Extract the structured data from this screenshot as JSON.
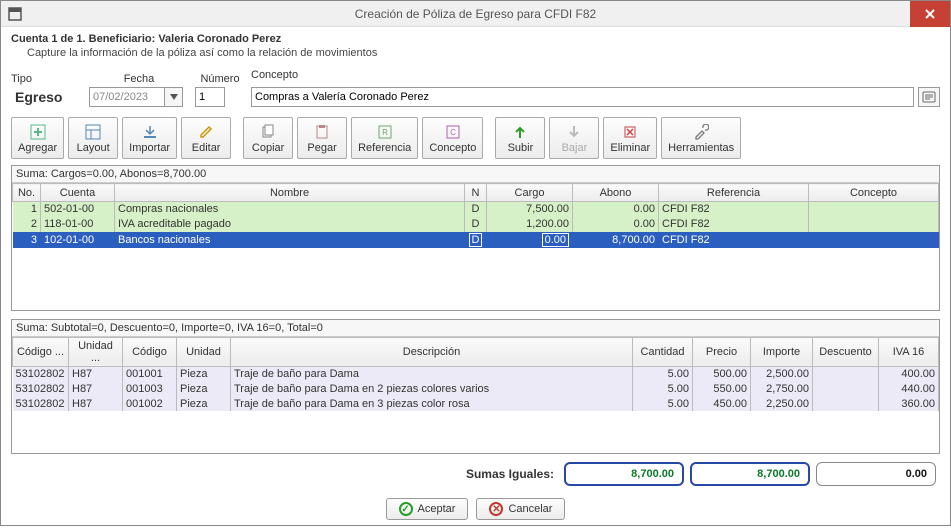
{
  "window": {
    "title": "Creación de Póliza de Egreso para CFDI F82"
  },
  "subheader": {
    "line1": "Cuenta 1 de 1. Beneficiario: Valeria Coronado Perez",
    "line2": "Capture la información de la póliza así como la relación de movimientos"
  },
  "form": {
    "labels": {
      "tipo": "Tipo",
      "fecha": "Fecha",
      "numero": "Número",
      "concepto": "Concepto"
    },
    "tipo_value": "Egreso",
    "fecha_value": "07/02/2023",
    "numero_value": "1",
    "concepto_value": "Compras a Valería Coronado Perez"
  },
  "toolbar": {
    "agregar": "Agregar",
    "layout": "Layout",
    "importar": "Importar",
    "editar": "Editar",
    "copiar": "Copiar",
    "pegar": "Pegar",
    "referencia": "Referencia",
    "concepto": "Concepto",
    "subir": "Subir",
    "bajar": "Bajar",
    "eliminar": "Eliminar",
    "herramientas": "Herramientas"
  },
  "movimientos": {
    "summary": "Suma:  Cargos=0.00, Abonos=8,700.00",
    "headers": {
      "no": "No.",
      "cuenta": "Cuenta",
      "nombre": "Nombre",
      "n": "N",
      "cargo": "Cargo",
      "abono": "Abono",
      "referencia": "Referencia",
      "concepto": "Concepto"
    },
    "rows": [
      {
        "no": "1",
        "cuenta": "502-01-00",
        "nombre": "Compras nacionales",
        "n": "D",
        "cargo": "7,500.00",
        "abono": "0.00",
        "referencia": "CFDI F82",
        "concepto": ""
      },
      {
        "no": "2",
        "cuenta": "118-01-00",
        "nombre": "IVA acreditable pagado",
        "n": "D",
        "cargo": "1,200.00",
        "abono": "0.00",
        "referencia": "CFDI F82",
        "concepto": ""
      },
      {
        "no": "3",
        "cuenta": "102-01-00",
        "nombre": "Bancos nacionales",
        "n": "D",
        "cargo": "0.00",
        "abono": "8,700.00",
        "referencia": "CFDI F82",
        "concepto": ""
      }
    ]
  },
  "detalle": {
    "summary": "Suma:  Subtotal=0, Descuento=0, Importe=0, IVA 16=0, Total=0",
    "headers": {
      "codigo_sat": "Código ...",
      "unidad_sat": "Unidad ...",
      "codigo": "Código",
      "unidad": "Unidad",
      "descripcion": "Descripción",
      "cantidad": "Cantidad",
      "precio": "Precio",
      "importe": "Importe",
      "descuento": "Descuento",
      "iva": "IVA 16"
    },
    "rows": [
      {
        "codigo_sat": "53102802",
        "unidad_sat": "H87",
        "codigo": "001001",
        "unidad": "Pieza",
        "descripcion": "Traje de baño para Dama",
        "cantidad": "5.00",
        "precio": "500.00",
        "importe": "2,500.00",
        "descuento": "",
        "iva": "400.00"
      },
      {
        "codigo_sat": "53102802",
        "unidad_sat": "H87",
        "codigo": "001003",
        "unidad": "Pieza",
        "descripcion": "Traje de baño para Dama en 2 piezas colores varios",
        "cantidad": "5.00",
        "precio": "550.00",
        "importe": "2,750.00",
        "descuento": "",
        "iva": "440.00"
      },
      {
        "codigo_sat": "53102802",
        "unidad_sat": "H87",
        "codigo": "001002",
        "unidad": "Pieza",
        "descripcion": "Traje de baño para Dama en 3 piezas color rosa",
        "cantidad": "5.00",
        "precio": "450.00",
        "importe": "2,250.00",
        "descuento": "",
        "iva": "360.00"
      }
    ]
  },
  "totals": {
    "label": "Sumas Iguales:",
    "cargos": "8,700.00",
    "abonos": "8,700.00",
    "diff": "0.00"
  },
  "footer": {
    "ok": "Aceptar",
    "cancel": "Cancelar"
  }
}
